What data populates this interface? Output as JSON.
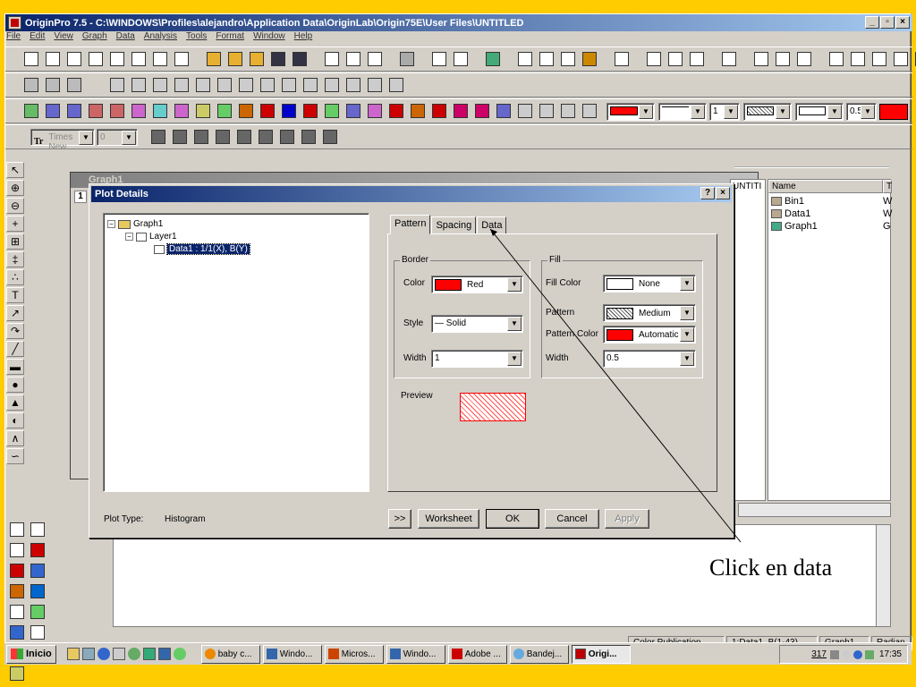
{
  "app": {
    "title": "OriginPro 7.5 - C:\\WINDOWS\\Profiles\\alejandro\\Application Data\\OriginLab\\Origin75E\\User Files\\UNTITLED"
  },
  "menu": [
    "File",
    "Edit",
    "View",
    "Graph",
    "Data",
    "Analysis",
    "Tools",
    "Format",
    "Window",
    "Help"
  ],
  "format_toolbar": {
    "font": "Times New",
    "size": "0",
    "buttons": [
      "B",
      "I",
      "U",
      "x²",
      "x₂",
      "x¹₂",
      "αβ",
      "A+",
      "A-"
    ]
  },
  "plot_toolbar": {
    "line_width": "1",
    "pattern_width": "0.5"
  },
  "graph_window": {
    "title": "Graph1",
    "layer": "1"
  },
  "dialog": {
    "title": "Plot Details",
    "help": "?",
    "close": "×",
    "tree": {
      "graph": "Graph1",
      "layer": "Layer1",
      "plot": "Data1 : 1/1(X), B(Y)"
    },
    "tabs": [
      "Pattern",
      "Spacing",
      "Data"
    ],
    "border": {
      "label": "Border",
      "color_label": "Color",
      "color_value": "Red",
      "style_label": "Style",
      "style_value": "— Solid",
      "width_label": "Width",
      "width_value": "1"
    },
    "fill": {
      "label": "Fill",
      "fill_color_label": "Fill Color",
      "fill_color_value": "None",
      "pattern_label": "Pattern",
      "pattern_value": "Medium",
      "pattern_color_label": "Pattern Color",
      "pattern_color_value": "Automatic",
      "width_label": "Width",
      "width_value": "0.5"
    },
    "preview_label": "Preview",
    "plot_type_label": "Plot Type:",
    "plot_type_value": "Histogram",
    "buttons": {
      "expand": ">>",
      "worksheet": "Worksheet",
      "ok": "OK",
      "cancel": "Cancel",
      "apply": "Apply"
    }
  },
  "explorer": {
    "folder": "UNTITI",
    "col_name": "Name",
    "col_type": "T",
    "items": [
      {
        "name": "Bin1",
        "type": "W"
      },
      {
        "name": "Data1",
        "type": "W"
      },
      {
        "name": "Graph1",
        "type": "G"
      }
    ]
  },
  "status": [
    "Color Publication",
    "1:Data1_B(1-43)",
    "Graph1",
    "Radian"
  ],
  "taskbar": {
    "start": "Inicio",
    "tasks": [
      "baby c...",
      "Windo...",
      "Micros...",
      "Windo...",
      "Adobe ...",
      "Bandej...",
      "Origi..."
    ],
    "clock": "17:35",
    "tray_num": "317"
  },
  "annotation": "Click en data",
  "colors": {
    "background": "#ffcc00",
    "accent_red": "#ff0000",
    "title_blue": "#0a246a"
  }
}
